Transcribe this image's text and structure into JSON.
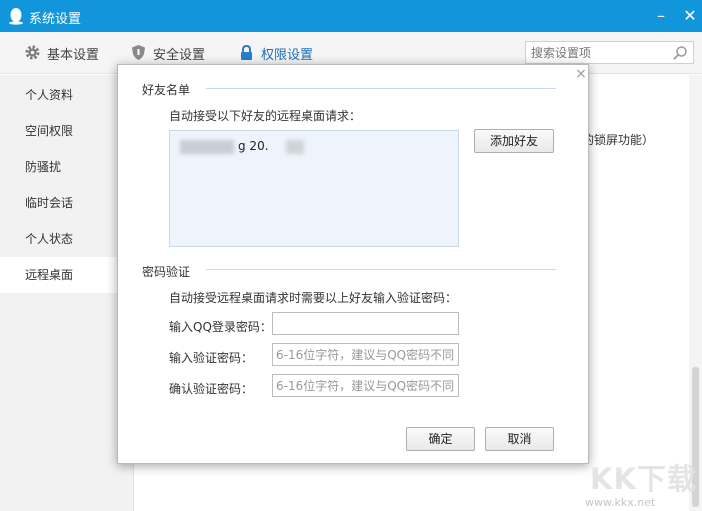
{
  "window": {
    "title": "系统设置",
    "minimize": "–",
    "close": "✕"
  },
  "topnav": {
    "tabs": [
      {
        "label": "基本设置",
        "icon": "gear-icon"
      },
      {
        "label": "安全设置",
        "icon": "shield-icon"
      },
      {
        "label": "权限设置",
        "icon": "lock-icon",
        "active": true
      }
    ],
    "search_placeholder": "搜索设置项"
  },
  "sidebar": {
    "items": [
      {
        "label": "个人资料"
      },
      {
        "label": "空间权限"
      },
      {
        "label": "防骚扰"
      },
      {
        "label": "临时会话"
      },
      {
        "label": "个人状态"
      },
      {
        "label": "远程桌面",
        "active": true
      }
    ]
  },
  "background": {
    "partial_text": "的锁屏功能）"
  },
  "dialog": {
    "close": "×",
    "friends_section": {
      "heading": "好友名单",
      "description": "自动接受以下好友的远程桌面请求：",
      "entries": [
        {
          "visible_text": "g     20."
        }
      ],
      "add_button": "添加好友"
    },
    "password_section": {
      "heading": "密码验证",
      "description": "自动接受远程桌面请求时需要以上好友输入验证密码：",
      "qq_password_label": "输入QQ登录密码：",
      "qq_password_value": "",
      "verify_label": "输入验证密码：",
      "verify_placeholder": "6-16位字符，建议与QQ密码不同",
      "confirm_label": "确认验证密码：",
      "confirm_placeholder": "6-16位字符，建议与QQ密码不同"
    },
    "ok_button": "确定",
    "cancel_button": "取消"
  },
  "watermark": {
    "logo_text": "KK下载",
    "url": "www.kkx.net"
  },
  "colors": {
    "titlebar": "#1296db",
    "accent": "#1e6fb8"
  }
}
